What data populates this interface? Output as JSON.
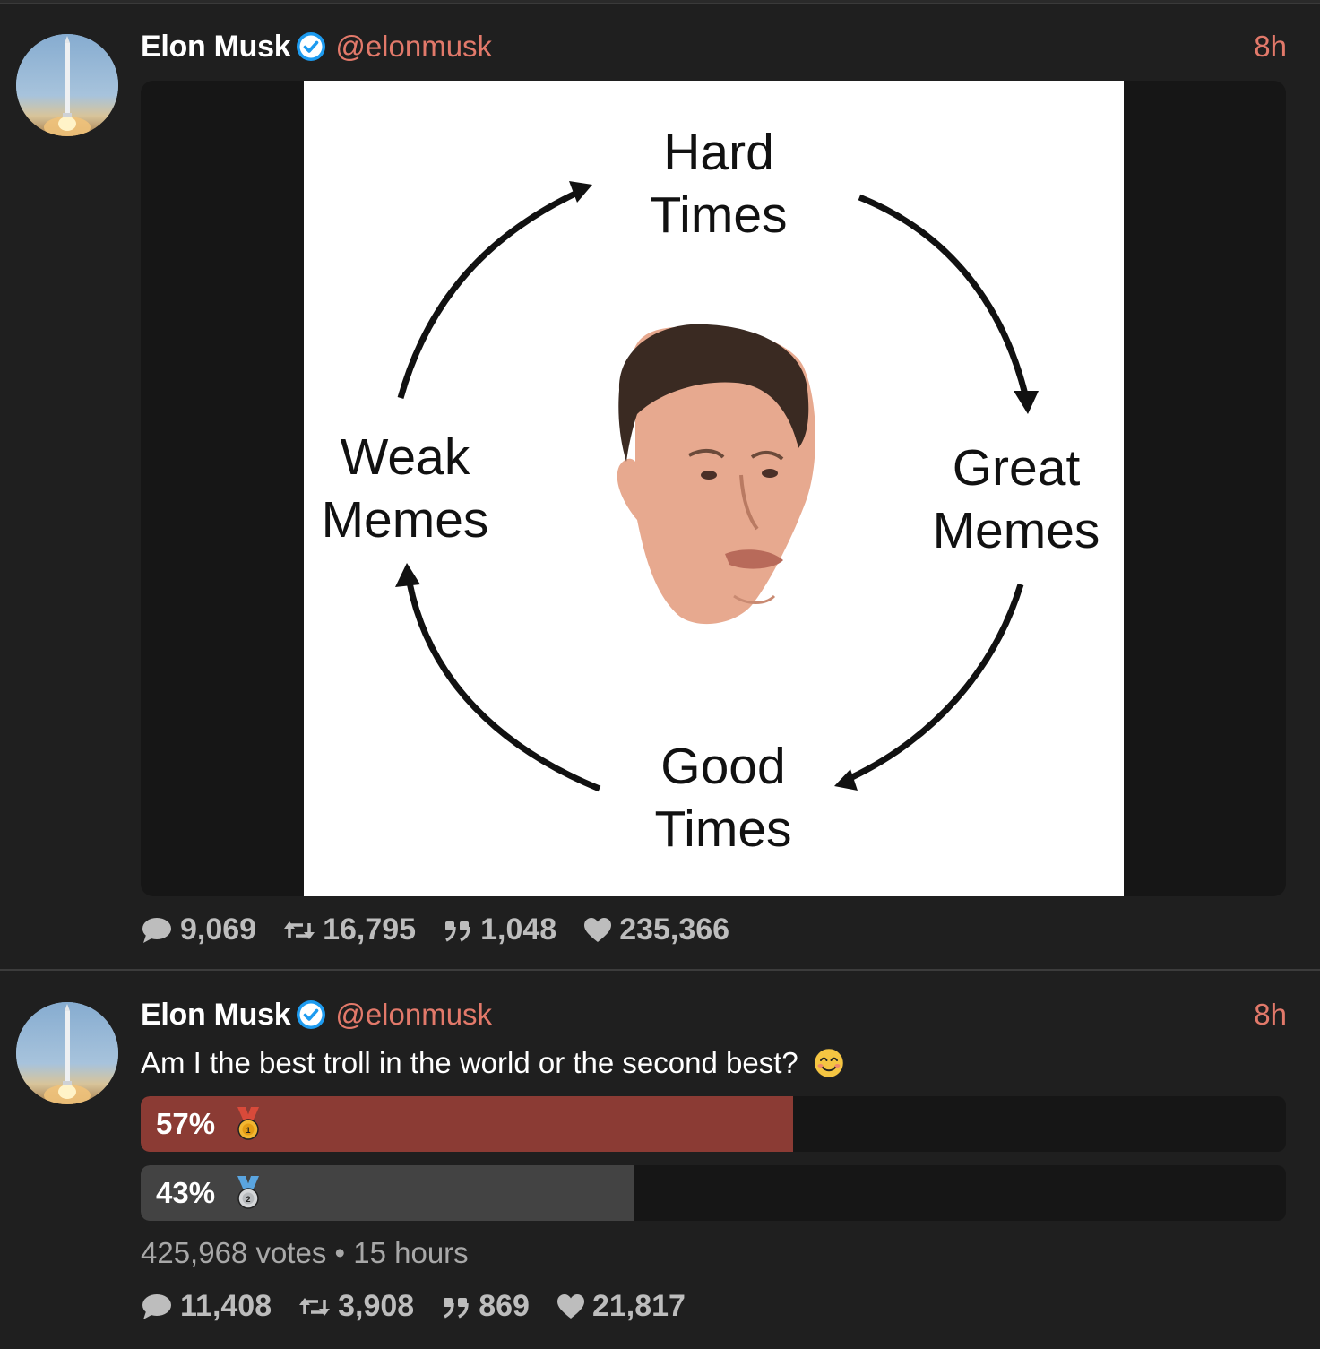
{
  "tweets": [
    {
      "author_name": "Elon Musk",
      "handle": "@elonmusk",
      "time": "8h",
      "media": {
        "top_label_1": "Hard",
        "top_label_2": "Times",
        "right_label_1": "Great",
        "right_label_2": "Memes",
        "bottom_label_1": "Good",
        "bottom_label_2": "Times",
        "left_label_1": "Weak",
        "left_label_2": "Memes"
      },
      "stats": {
        "replies": "9,069",
        "retweets": "16,795",
        "quotes": "1,048",
        "likes": "235,366"
      }
    },
    {
      "author_name": "Elon Musk",
      "handle": "@elonmusk",
      "time": "8h",
      "text": "Am I the best troll in the world or the second best?",
      "poll": {
        "options": [
          {
            "percent_label": "57%",
            "fraction": 0.57,
            "color": "#8b3b34",
            "icon": "gold-medal-icon"
          },
          {
            "percent_label": "43%",
            "fraction": 0.43,
            "color": "#434343",
            "icon": "silver-medal-icon"
          }
        ],
        "votes": "425,968 votes",
        "separator": "•",
        "duration": "15 hours"
      },
      "stats": {
        "replies": "11,408",
        "retweets": "3,908",
        "quotes": "869",
        "likes": "21,817"
      }
    }
  ],
  "colors": {
    "accent": "#e2796a",
    "verified": "#1d9bf0",
    "background": "#1f1f1f"
  }
}
